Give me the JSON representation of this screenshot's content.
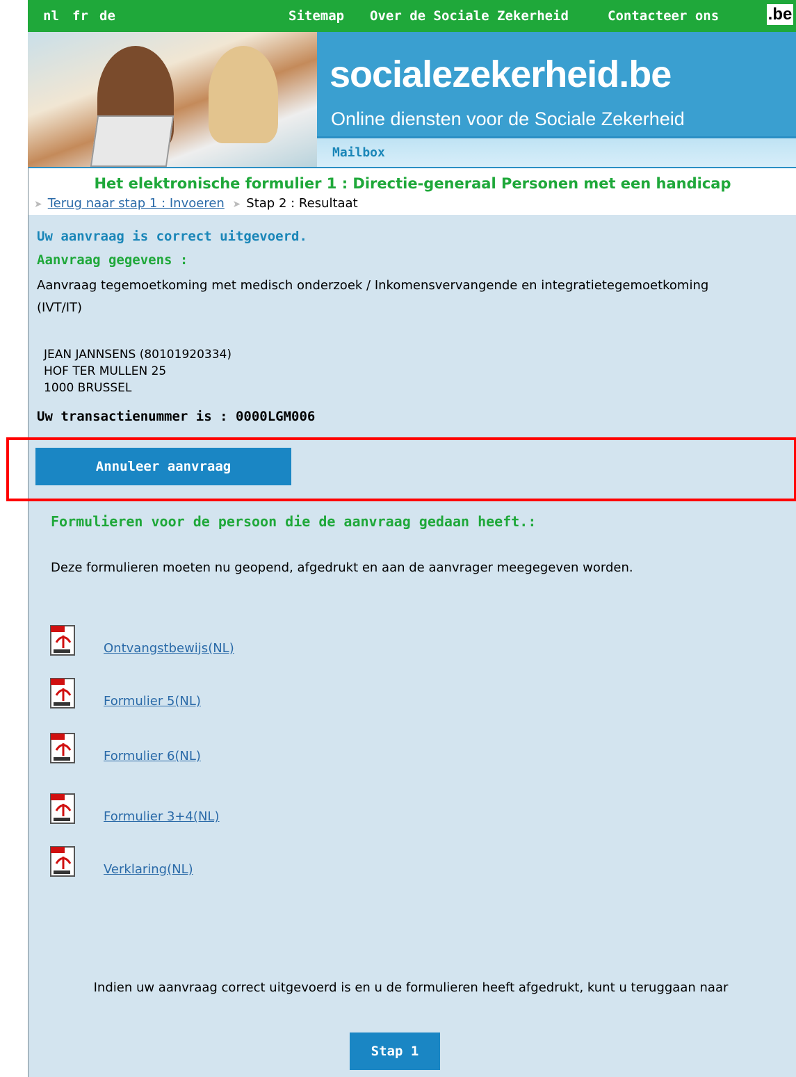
{
  "topbar": {
    "languages": [
      "nl",
      "fr",
      "de"
    ],
    "links": [
      "Sitemap",
      "Over de Sociale Zekerheid",
      "Contacteer ons"
    ],
    "logo_text": ".be"
  },
  "banner": {
    "site_title": "socialezekerheid.be",
    "subtitle": "Online diensten voor de Sociale Zekerheid",
    "section": "Mailbox"
  },
  "form": {
    "title": "Het elektronische formulier 1 : Directie-generaal Personen met een handicap",
    "breadcrumb_back": "Terug naar stap 1 : Invoeren",
    "breadcrumb_current": "Stap 2 : Resultaat"
  },
  "result": {
    "success": "Uw aanvraag is correct uitgevoerd.",
    "details_heading": "Aanvraag gegevens :",
    "details_text": "Aanvraag tegemoetkoming met medisch onderzoek  /  Inkomensvervangende en integratietegemoetkoming (IVT/IT)",
    "address_lines": [
      "JEAN JANNSENS (80101920334)",
      "HOF TER MULLEN 25",
      "1000 BRUSSEL"
    ],
    "transaction_label": "Uw transactienummer is : ",
    "transaction_number": "0000LGM006",
    "cancel_button": "Annuleer aanvraag"
  },
  "forms": {
    "heading": "Formulieren voor de persoon die de aanvraag gedaan heeft.:",
    "instructions": "Deze formulieren moeten nu geopend, afgedrukt en aan de aanvrager meegegeven worden.",
    "documents": [
      "Ontvangstbewijs(NL)",
      "Formulier 5(NL)",
      "Formulier 6(NL)",
      "Formulier 3+4(NL)",
      "Verklaring(NL)"
    ]
  },
  "footer": {
    "text": "Indien uw aanvraag correct uitgevoerd is en u de formulieren heeft afgedrukt, kunt u teruggaan naar",
    "button": "Stap 1"
  },
  "colors": {
    "green": "#1fa83a",
    "blue": "#1a86c4",
    "content_bg": "#d3e4ef",
    "highlight": "#ff0000"
  }
}
